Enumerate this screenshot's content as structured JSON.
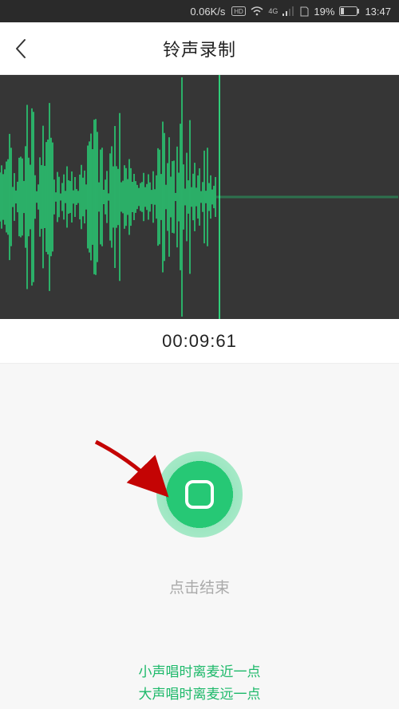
{
  "status_bar": {
    "net_speed": "0.06K/s",
    "battery_percent": "19%",
    "time": "13:47",
    "network_label": "4G",
    "hd_label": "HD"
  },
  "header": {
    "title": "铃声录制"
  },
  "timer": "00:09:61",
  "control": {
    "stop_label": "点击结束"
  },
  "tips": {
    "line1": "小声唱时离麦近一点",
    "line2": "大声唱时离麦远一点"
  },
  "colors": {
    "accent": "#26c875",
    "bg_dark": "#363636"
  }
}
